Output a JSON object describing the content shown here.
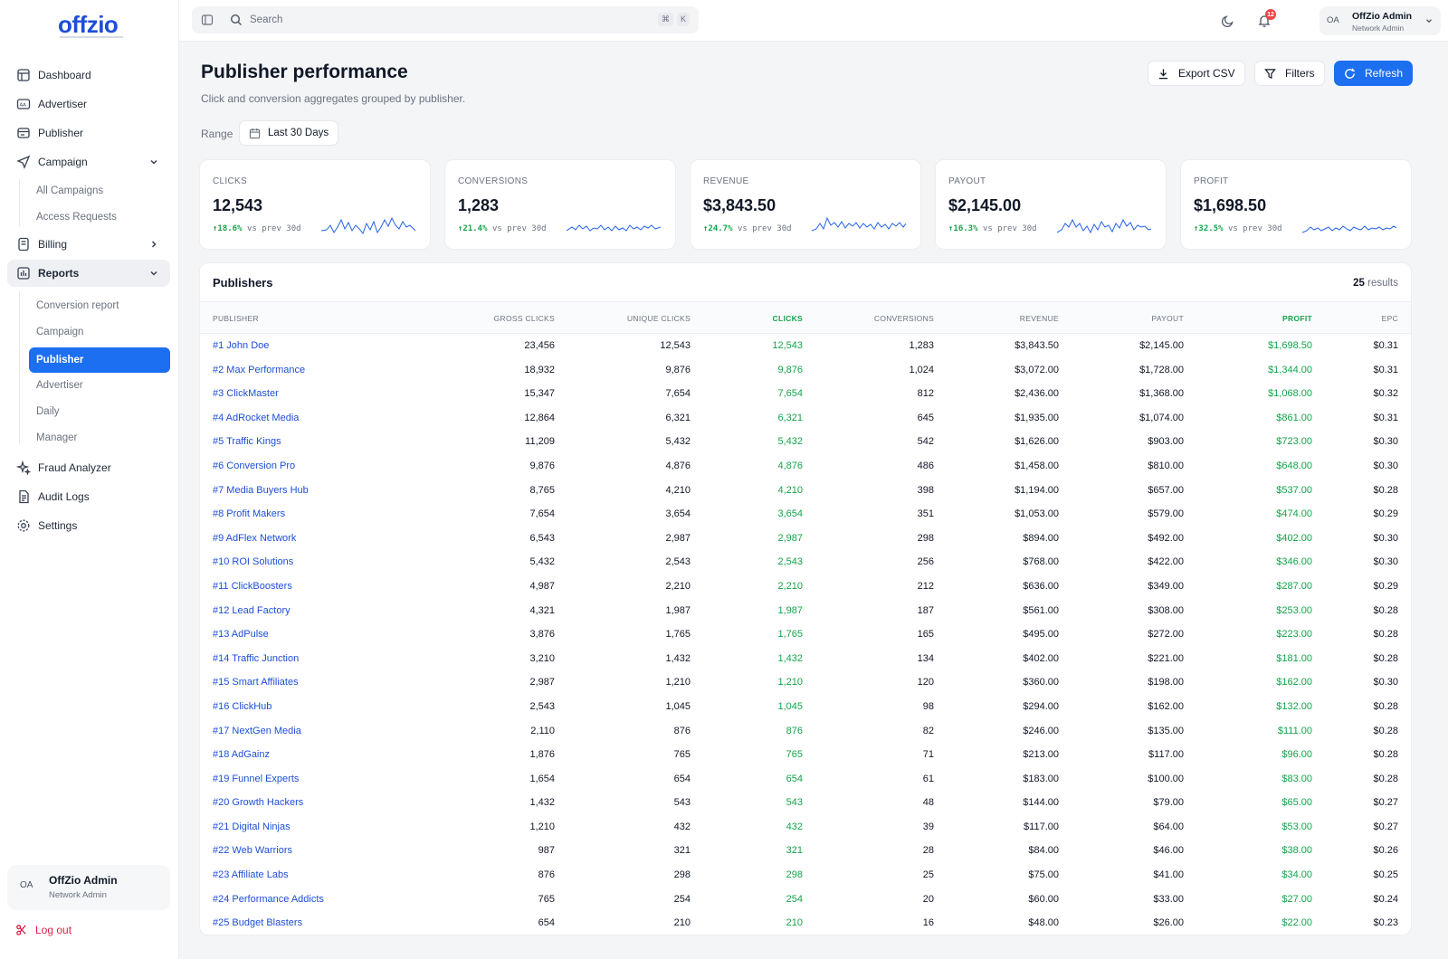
{
  "brand": {
    "logo": "offzio"
  },
  "sidebar": {
    "items": [
      {
        "label": "Dashboard",
        "icon": "dashboard-icon"
      },
      {
        "label": "Advertiser",
        "icon": "advertiser-icon"
      },
      {
        "label": "Publisher",
        "icon": "publisher-icon"
      },
      {
        "label": "Campaign",
        "icon": "campaign-icon"
      },
      {
        "label": "Billing",
        "icon": "billing-icon"
      },
      {
        "label": "Reports",
        "icon": "reports-icon"
      },
      {
        "label": "Fraud Analyzer",
        "icon": "sparkle-icon"
      },
      {
        "label": "Audit Logs",
        "icon": "audit-icon"
      },
      {
        "label": "Settings",
        "icon": "gear-icon"
      }
    ],
    "campaign_sub": [
      "All Campaigns",
      "Access Requests"
    ],
    "reports_sub": [
      "Conversion report",
      "Campaign",
      "Publisher",
      "Advertiser",
      "Daily",
      "Manager"
    ],
    "user": {
      "initials": "OA",
      "name": "OffZio Admin",
      "role": "Network Admin"
    },
    "logout": "Log out"
  },
  "topbar": {
    "search_placeholder": "Search",
    "shortcut": [
      "⌘",
      "K"
    ],
    "notifications": "12",
    "user": {
      "initials": "OA",
      "name": "OffZio Admin",
      "role": "Network Admin"
    }
  },
  "page": {
    "title": "Publisher performance",
    "subtitle": "Click and conversion aggregates grouped by publisher.",
    "export_label": "Export CSV",
    "filters_label": "Filters",
    "refresh_label": "Refresh",
    "range_label": "Range",
    "range_value": "Last 30 Days"
  },
  "colors": {
    "accent": "#1d6ff2",
    "positive": "#16a34a",
    "link": "#1d4ed8"
  },
  "kpis": [
    {
      "label": "CLICKS",
      "value": "12,543",
      "change": "↑18.6%",
      "vs": "vs prev 30d"
    },
    {
      "label": "CONVERSIONS",
      "value": "1,283",
      "change": "↑21.4%",
      "vs": "vs prev 30d"
    },
    {
      "label": "REVENUE",
      "value": "$3,843.50",
      "change": "↑24.7%",
      "vs": "vs prev 30d"
    },
    {
      "label": "PAYOUT",
      "value": "$2,145.00",
      "change": "↑16.3%",
      "vs": "vs prev 30d"
    },
    {
      "label": "PROFIT",
      "value": "$1,698.50",
      "change": "↑32.5%",
      "vs": "vs prev 30d"
    }
  ],
  "table": {
    "title": "Publishers",
    "results_count": "25",
    "results_label": "results",
    "columns": [
      "PUBLISHER",
      "GROSS CLICKS",
      "UNIQUE CLICKS",
      "CLICKS",
      "CONVERSIONS",
      "REVENUE",
      "PAYOUT",
      "PROFIT",
      "EPC"
    ],
    "rows": [
      [
        "#1 John Doe",
        "23,456",
        "12,543",
        "12,543",
        "1,283",
        "$3,843.50",
        "$2,145.00",
        "$1,698.50",
        "$0.31"
      ],
      [
        "#2 Max Performance",
        "18,932",
        "9,876",
        "9,876",
        "1,024",
        "$3,072.00",
        "$1,728.00",
        "$1,344.00",
        "$0.31"
      ],
      [
        "#3 ClickMaster",
        "15,347",
        "7,654",
        "7,654",
        "812",
        "$2,436.00",
        "$1,368.00",
        "$1,068.00",
        "$0.32"
      ],
      [
        "#4 AdRocket Media",
        "12,864",
        "6,321",
        "6,321",
        "645",
        "$1,935.00",
        "$1,074.00",
        "$861.00",
        "$0.31"
      ],
      [
        "#5 Traffic Kings",
        "11,209",
        "5,432",
        "5,432",
        "542",
        "$1,626.00",
        "$903.00",
        "$723.00",
        "$0.30"
      ],
      [
        "#6 Conversion Pro",
        "9,876",
        "4,876",
        "4,876",
        "486",
        "$1,458.00",
        "$810.00",
        "$648.00",
        "$0.30"
      ],
      [
        "#7 Media Buyers Hub",
        "8,765",
        "4,210",
        "4,210",
        "398",
        "$1,194.00",
        "$657.00",
        "$537.00",
        "$0.28"
      ],
      [
        "#8 Profit Makers",
        "7,654",
        "3,654",
        "3,654",
        "351",
        "$1,053.00",
        "$579.00",
        "$474.00",
        "$0.29"
      ],
      [
        "#9 AdFlex Network",
        "6,543",
        "2,987",
        "2,987",
        "298",
        "$894.00",
        "$492.00",
        "$402.00",
        "$0.30"
      ],
      [
        "#10 ROI Solutions",
        "5,432",
        "2,543",
        "2,543",
        "256",
        "$768.00",
        "$422.00",
        "$346.00",
        "$0.30"
      ],
      [
        "#11 ClickBoosters",
        "4,987",
        "2,210",
        "2,210",
        "212",
        "$636.00",
        "$349.00",
        "$287.00",
        "$0.29"
      ],
      [
        "#12 Lead Factory",
        "4,321",
        "1,987",
        "1,987",
        "187",
        "$561.00",
        "$308.00",
        "$253.00",
        "$0.28"
      ],
      [
        "#13 AdPulse",
        "3,876",
        "1,765",
        "1,765",
        "165",
        "$495.00",
        "$272.00",
        "$223.00",
        "$0.28"
      ],
      [
        "#14 Traffic Junction",
        "3,210",
        "1,432",
        "1,432",
        "134",
        "$402.00",
        "$221.00",
        "$181.00",
        "$0.28"
      ],
      [
        "#15 Smart Affiliates",
        "2,987",
        "1,210",
        "1,210",
        "120",
        "$360.00",
        "$198.00",
        "$162.00",
        "$0.30"
      ],
      [
        "#16 ClickHub",
        "2,543",
        "1,045",
        "1,045",
        "98",
        "$294.00",
        "$162.00",
        "$132.00",
        "$0.28"
      ],
      [
        "#17 NextGen Media",
        "2,110",
        "876",
        "876",
        "82",
        "$246.00",
        "$135.00",
        "$111.00",
        "$0.28"
      ],
      [
        "#18 AdGainz",
        "1,876",
        "765",
        "765",
        "71",
        "$213.00",
        "$117.00",
        "$96.00",
        "$0.28"
      ],
      [
        "#19 Funnel Experts",
        "1,654",
        "654",
        "654",
        "61",
        "$183.00",
        "$100.00",
        "$83.00",
        "$0.28"
      ],
      [
        "#20 Growth Hackers",
        "1,432",
        "543",
        "543",
        "48",
        "$144.00",
        "$79.00",
        "$65.00",
        "$0.27"
      ],
      [
        "#21 Digital Ninjas",
        "1,210",
        "432",
        "432",
        "39",
        "$117.00",
        "$64.00",
        "$53.00",
        "$0.27"
      ],
      [
        "#22 Web Warriors",
        "987",
        "321",
        "321",
        "28",
        "$84.00",
        "$46.00",
        "$38.00",
        "$0.26"
      ],
      [
        "#23 Affiliate Labs",
        "876",
        "298",
        "298",
        "25",
        "$75.00",
        "$41.00",
        "$34.00",
        "$0.25"
      ],
      [
        "#24 Performance Addicts",
        "765",
        "254",
        "254",
        "20",
        "$60.00",
        "$33.00",
        "$27.00",
        "$0.24"
      ],
      [
        "#25 Budget Blasters",
        "654",
        "210",
        "210",
        "16",
        "$48.00",
        "$26.00",
        "$22.00",
        "$0.23"
      ]
    ]
  }
}
